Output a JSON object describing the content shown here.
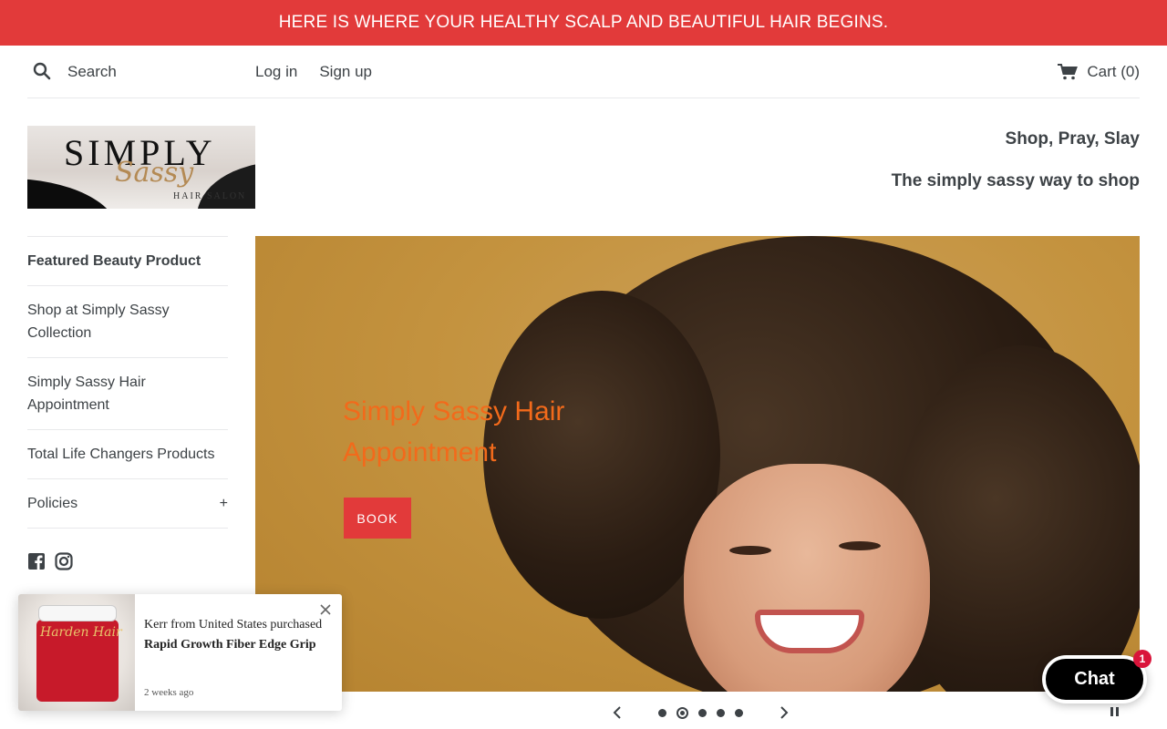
{
  "announcement": {
    "text": "HERE IS WHERE YOUR HEALTHY SCALP AND BEAUTIFUL HAIR BEGINS."
  },
  "topnav": {
    "search_label": "Search",
    "search_placeholder": "Search",
    "login": "Log in",
    "signup": "Sign up",
    "cart": "Cart (0)"
  },
  "brand": {
    "logo_top": "SIMPLY",
    "logo_script": "Sassy",
    "logo_sub": "HAIR SALON",
    "tagline1": "Shop, Pray, Slay",
    "tagline2": "The simply sassy way to shop"
  },
  "sidebar": {
    "items": [
      {
        "label": "Featured Beauty Product",
        "active": true
      },
      {
        "label": "Shop at Simply Sassy Collection"
      },
      {
        "label": "Simply Sassy Hair Appointment"
      },
      {
        "label": "Total Life Changers Products"
      },
      {
        "label": "Policies",
        "expand": "+"
      }
    ],
    "social": [
      "facebook-icon",
      "instagram-icon"
    ]
  },
  "slideshow": {
    "title": "Simply Sassy Hair Appointment",
    "button": "BOOK",
    "slide_count": 5,
    "current_slide": 2
  },
  "popup": {
    "line1": "Kerr from United States purchased",
    "product": "Rapid Growth Fiber Edge Grip",
    "time": "2 weeks ago",
    "product_image_label": "Harden Hair"
  },
  "chat": {
    "label": "Chat",
    "badge": "1"
  },
  "colors": {
    "accent": "#e23a3a",
    "title_orange": "#f26a1b",
    "text": "#3d4246"
  }
}
